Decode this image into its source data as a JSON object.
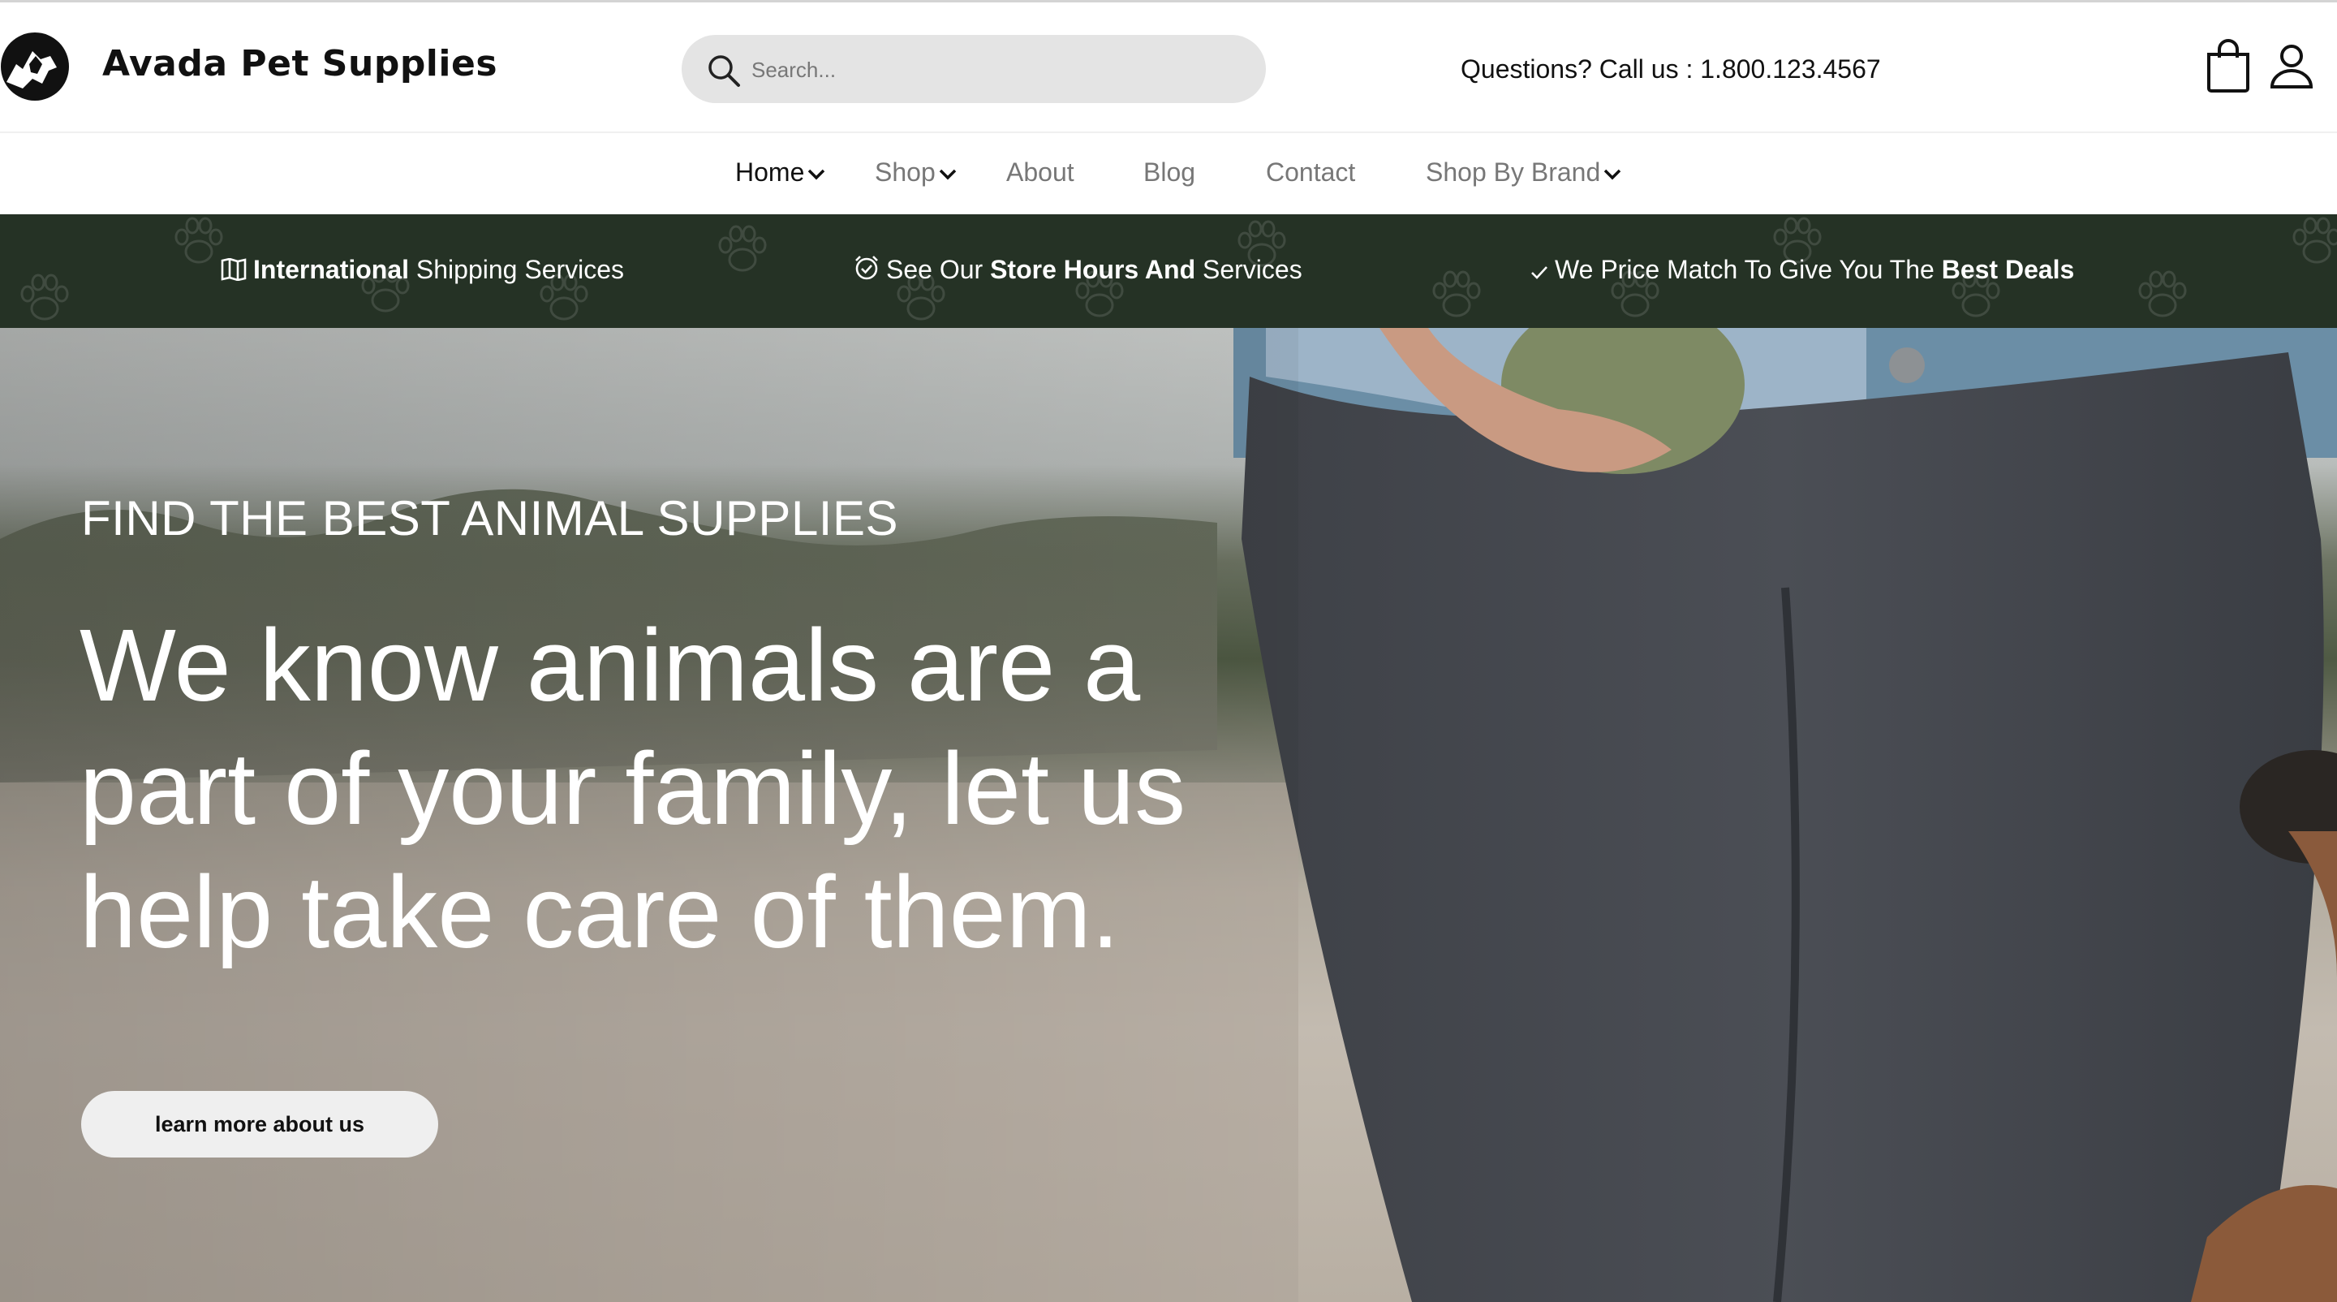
{
  "header": {
    "brand": "Avada Pet Supplies",
    "search_placeholder": "Search...",
    "phone_text": "Questions? Call us : 1.800.123.4567",
    "icons": [
      "logo-pet-icon",
      "search-icon",
      "shopping-bag-icon",
      "user-icon"
    ]
  },
  "nav": {
    "items": [
      {
        "label": "Home",
        "dropdown": true,
        "active": true
      },
      {
        "label": "Shop",
        "dropdown": true
      },
      {
        "label": "About"
      },
      {
        "label": "Blog"
      },
      {
        "label": "Contact"
      },
      {
        "label": "Shop By Brand",
        "dropdown": true
      }
    ]
  },
  "info_bar": {
    "item1": {
      "icon": "map-icon",
      "bold": "International",
      "rest": " Shipping Services"
    },
    "item2": {
      "icon": "alarm-clock-icon",
      "pre": "See Our ",
      "bold": "Store Hours And",
      "post": " Services"
    },
    "item3": {
      "icon": "checkmark-icon",
      "pre": "We Price Match To Give You The ",
      "bold": "Best Deals"
    }
  },
  "hero": {
    "eyebrow": "FIND THE BEST ANIMAL SUPPLIES",
    "headline": "We know animals are a part of your family, let us help take care of them.",
    "cta_label": "learn more about us"
  },
  "colors": {
    "info_bar_bg": "#253225",
    "search_bg": "#e4e4e4",
    "cta_bg": "#efefef",
    "text_dark": "#111111",
    "nav_muted": "#777777"
  }
}
